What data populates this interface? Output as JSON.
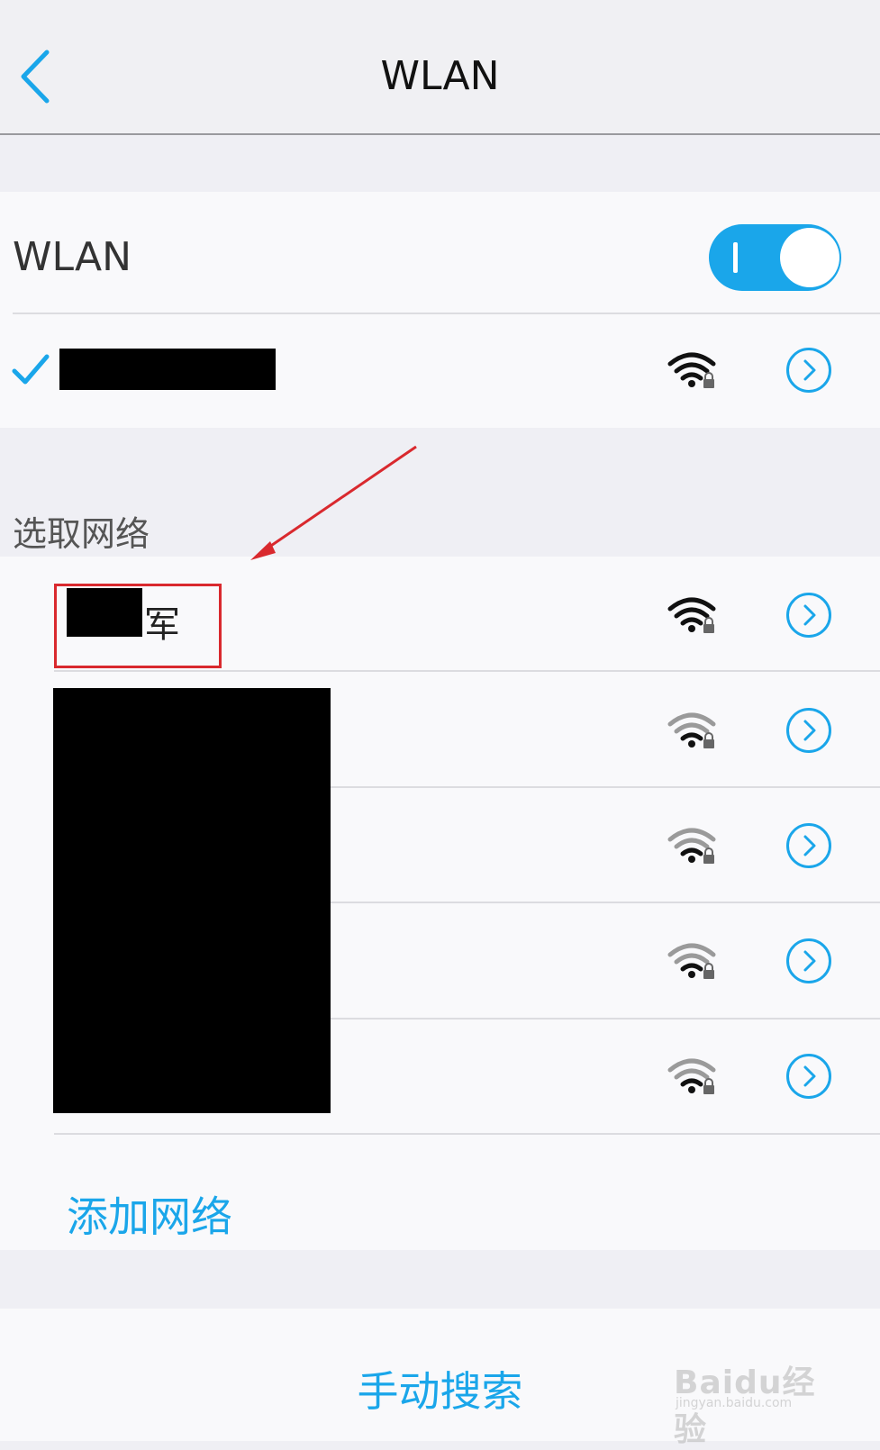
{
  "nav": {
    "title": "WLAN",
    "back_icon": "chevron-left-icon"
  },
  "wlan": {
    "label": "WLAN",
    "enabled": true,
    "toggle_on_glyph": "I"
  },
  "connected_network": {
    "connected": true,
    "secured": true,
    "signal": "strong"
  },
  "available": {
    "header": "选取网络",
    "networks": [
      {
        "name_visible_suffix": "军",
        "secured": true,
        "signal": "strong"
      },
      {
        "secured": true,
        "signal": "weak"
      },
      {
        "secured": true,
        "signal": "weak"
      },
      {
        "secured": true,
        "signal": "weak"
      },
      {
        "secured": true,
        "signal": "weak"
      }
    ],
    "add_network_label": "添加网络"
  },
  "manual_search_label": "手动搜索",
  "watermark": {
    "text": "Baidu经验",
    "subtext": "jingyan.baidu.com"
  },
  "colors": {
    "accent": "#1aa6ea",
    "annotation": "#d9292e",
    "background": "#efeff4"
  }
}
